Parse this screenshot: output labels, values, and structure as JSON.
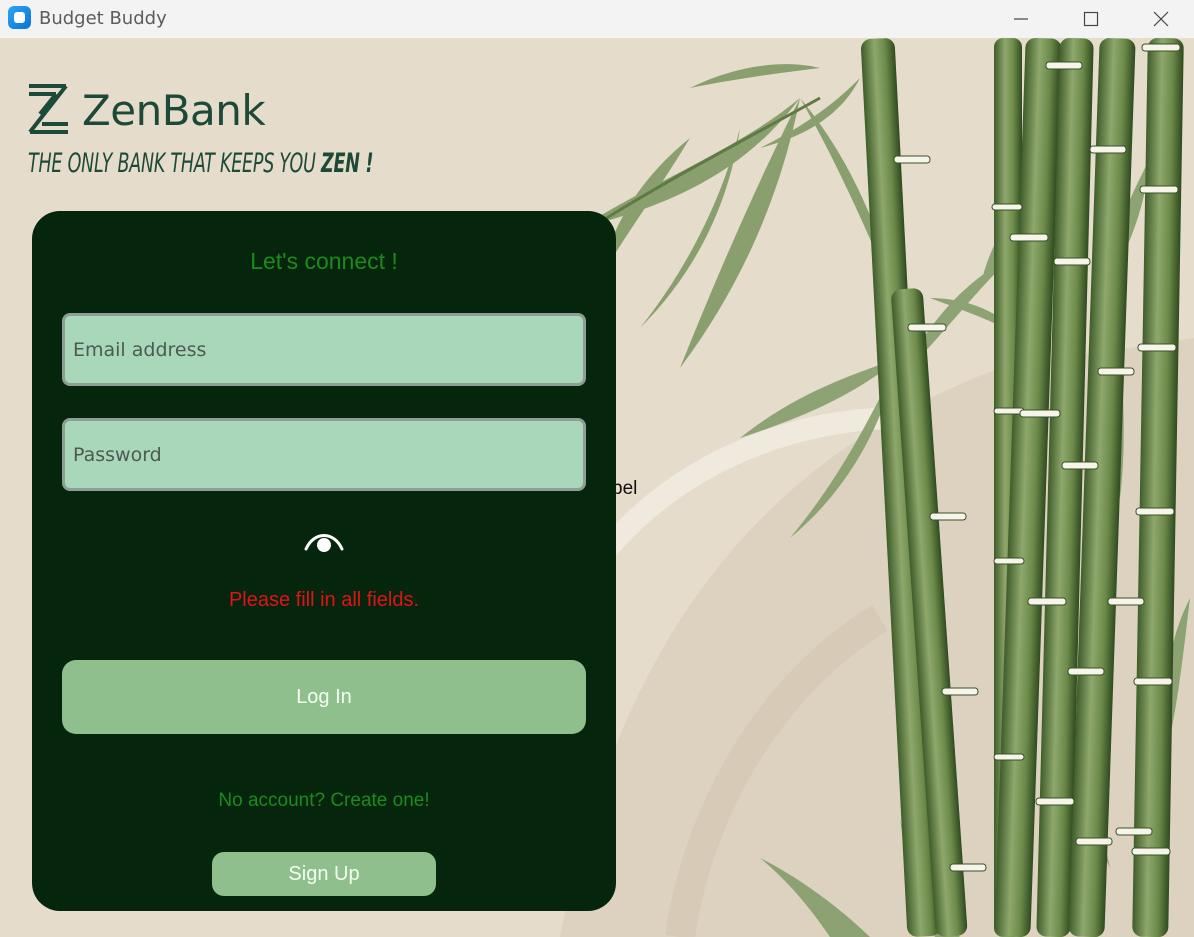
{
  "window": {
    "title": "Budget Buddy",
    "controls": {
      "minimize": "minimize-icon",
      "maximize": "maximize-icon",
      "close": "close-icon"
    }
  },
  "brand": {
    "name": "ZenBank",
    "tagline_prefix": "THE ONLY BANK THAT KEEPS YOU ",
    "tagline_emphasis": "ZEN !",
    "color": "#1d4a38"
  },
  "stray_label": "bel",
  "login": {
    "heading": "Let's connect !",
    "email_placeholder": "Email address",
    "password_placeholder": "Password",
    "toggle_icon": "eye-icon",
    "error": "Please fill in all fields.",
    "login_button": "Log In",
    "no_account_text": "No account? Create one!",
    "signup_button": "Sign Up"
  },
  "colors": {
    "card_bg": "#05260c",
    "accent_green": "#1e8a1e",
    "button_green": "#8fbf8c",
    "input_bg": "#a8d8b9",
    "error_red": "#e11414"
  }
}
